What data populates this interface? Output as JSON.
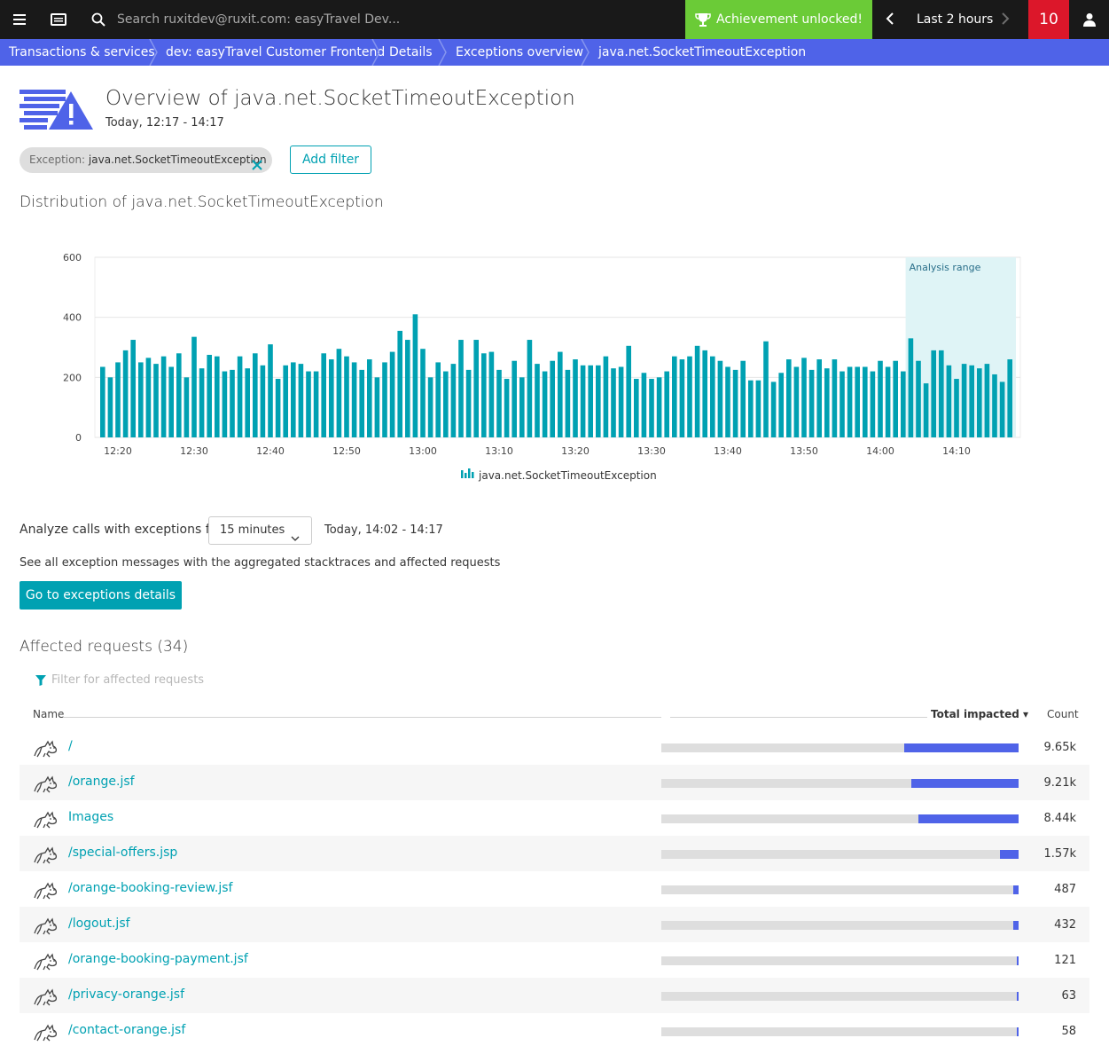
{
  "topbar": {
    "search_placeholder": "Search ruxitdev@ruxit.com: easyTravel Dev...",
    "achievement": "Achievement unlocked!",
    "timeframe": "Last 2 hours",
    "problem_count": "10"
  },
  "breadcrumb": [
    "Transactions & services",
    "dev: easyTravel Customer Frontend",
    "Details",
    "Exceptions overview",
    "java.net.SocketTimeoutException"
  ],
  "header": {
    "title": "Overview of java.net.SocketTimeoutException",
    "subtitle": "Today, 12:17 - 14:17"
  },
  "filters": {
    "chip_key": "Exception: ",
    "chip_value": "java.net.SocketTimeoutException",
    "add_filter_label": "Add filter"
  },
  "distribution": {
    "title": "Distribution of java.net.SocketTimeoutException"
  },
  "chart_data": {
    "type": "bar",
    "title": "",
    "xlabel": "",
    "ylabel": "",
    "ylim": [
      0,
      600
    ],
    "y_ticks": [
      "0",
      "200",
      "400",
      "600"
    ],
    "x_ticks": [
      "12:20",
      "12:30",
      "12:40",
      "12:50",
      "13:00",
      "13:10",
      "13:20",
      "13:30",
      "13:40",
      "13:50",
      "14:00",
      "14:10"
    ],
    "legend": "java.net.SocketTimeoutException",
    "annotation": "Analysis range",
    "analysis_range_start_index": 106,
    "grid": true,
    "color": "#00a1b2",
    "series": [
      {
        "name": "java.net.SocketTimeoutException",
        "values": [
          235,
          200,
          250,
          290,
          325,
          250,
          265,
          245,
          270,
          235,
          280,
          200,
          335,
          230,
          275,
          270,
          220,
          225,
          270,
          230,
          280,
          240,
          310,
          195,
          240,
          250,
          245,
          220,
          220,
          280,
          260,
          295,
          270,
          250,
          225,
          260,
          200,
          250,
          285,
          355,
          325,
          410,
          295,
          200,
          250,
          220,
          245,
          325,
          225,
          325,
          280,
          285,
          225,
          195,
          255,
          200,
          325,
          245,
          220,
          255,
          285,
          225,
          260,
          240,
          240,
          240,
          270,
          230,
          235,
          305,
          195,
          215,
          195,
          200,
          220,
          270,
          260,
          270,
          305,
          290,
          270,
          255,
          235,
          225,
          255,
          190,
          190,
          320,
          185,
          215,
          260,
          235,
          265,
          225,
          260,
          230,
          260,
          220,
          235,
          235,
          235,
          220,
          255,
          235,
          255,
          220,
          330,
          255,
          180,
          290,
          290,
          240,
          195,
          245,
          240,
          230,
          245,
          210,
          185,
          260
        ]
      }
    ]
  },
  "analyze": {
    "label": "Analyze calls with exceptions for",
    "select_value": "15 minutes",
    "range": "Today, 14:02 - 14:17",
    "see_all": "See all exception messages with the aggregated stacktraces and affected requests",
    "button": "Go to exceptions details"
  },
  "affected": {
    "title": "Affected requests (34)",
    "filter_placeholder": "Filter for affected requests",
    "col_name": "Name",
    "col_total": "Total impacted",
    "col_count": "Count",
    "rows": [
      {
        "name": "/",
        "count": "9.65k",
        "share": 0.32
      },
      {
        "name": "/orange.jsf",
        "count": "9.21k",
        "share": 0.3
      },
      {
        "name": "Images",
        "count": "8.44k",
        "share": 0.28
      },
      {
        "name": "/special-offers.jsp",
        "count": "1.57k",
        "share": 0.052
      },
      {
        "name": "/orange-booking-review.jsf",
        "count": "487",
        "share": 0.016
      },
      {
        "name": "/logout.jsf",
        "count": "432",
        "share": 0.014
      },
      {
        "name": "/orange-booking-payment.jsf",
        "count": "121",
        "share": 0.004
      },
      {
        "name": "/privacy-orange.jsf",
        "count": "63",
        "share": 0.002
      },
      {
        "name": "/contact-orange.jsf",
        "count": "58",
        "share": 0.002
      }
    ]
  }
}
